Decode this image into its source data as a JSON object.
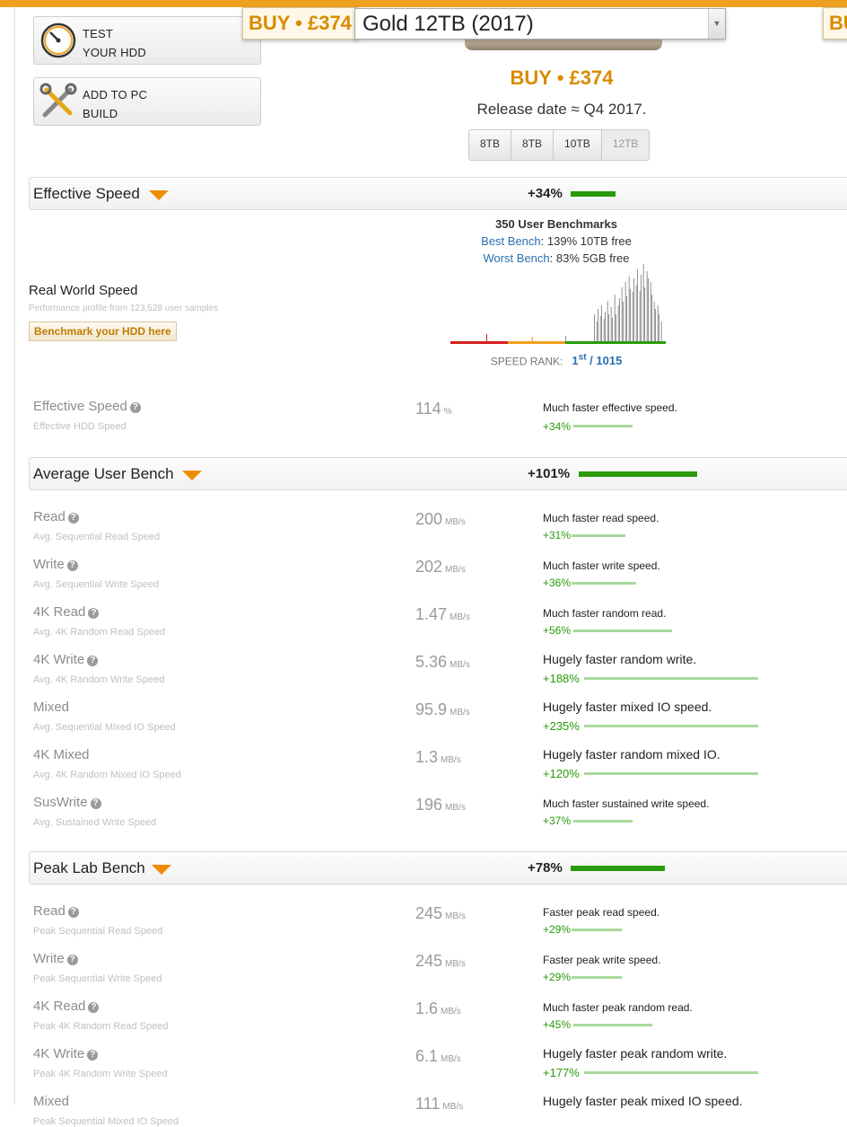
{
  "colors": {
    "accent": "#d98b00",
    "good": "#2a9a0c",
    "link": "#2a6fb0"
  },
  "tools": [
    {
      "line1": "TEST",
      "line2": "YOUR HDD",
      "icon": "gauge-icon"
    },
    {
      "line1": "ADD TO PC",
      "line2": "BUILD",
      "icon": "tools-icon"
    }
  ],
  "buybar": {
    "buy_label": "BUY • £374",
    "model_value": "Gold 12TB (2017)",
    "buy_label_right": "BU"
  },
  "product": {
    "buy_price": "BUY • £374",
    "release": "Release date ≈ Q4 2017.",
    "capacities": [
      "8TB",
      "8TB",
      "10TB",
      "12TB"
    ]
  },
  "effective_speed": {
    "header": {
      "title": "Effective Speed",
      "pct": "+34%"
    },
    "user_bench": {
      "title": "350 User Benchmarks",
      "best_label": "Best Bench",
      "best_value": ": 139% 10TB free",
      "worst_label": "Worst Bench",
      "worst_value": ": 83% 5GB free"
    },
    "rws_title": "Real World Speed",
    "rws_sub": "Performance profile from 123,528 user samples",
    "bench_button": "Benchmark your HDD here",
    "rank_label": "SPEED RANK:",
    "rank_pos": "1",
    "rank_sup": "st",
    "rank_total": " / 1015",
    "metric": {
      "name": "Effective Speed",
      "sub": "Effective HDD Speed",
      "value": "114",
      "unit": "%",
      "desc": "Much faster effective speed.",
      "pct": "+34%"
    }
  },
  "avg_user_bench": {
    "header": {
      "title": "Average User Bench",
      "pct": "+101%"
    },
    "rows": [
      {
        "name": "Read",
        "sub": "Avg. Sequential Read Speed",
        "value": "200",
        "unit": "MB/s",
        "desc": "Much faster read speed.",
        "pct": "+31%"
      },
      {
        "name": "Write",
        "sub": "Avg. Sequential Write Speed",
        "value": "202",
        "unit": "MB/s",
        "desc": "Much faster write speed.",
        "pct": "+36%"
      },
      {
        "name": "4K Read",
        "sub": "Avg. 4K Random Read Speed",
        "value": "1.47",
        "unit": "MB/s",
        "desc": "Much faster random read.",
        "pct": "+56%"
      },
      {
        "name": "4K Write",
        "sub": "Avg. 4K Random Write Speed",
        "value": "5.36",
        "unit": "MB/s",
        "desc": "Hugely faster random write.",
        "pct": "+188%"
      },
      {
        "name": "Mixed",
        "sub": "Avg. Sequential Mixed IO Speed",
        "value": "95.9",
        "unit": "MB/s",
        "desc": "Hugely faster mixed IO speed.",
        "pct": "+235%"
      },
      {
        "name": "4K Mixed",
        "sub": "Avg. 4K Random Mixed IO Speed",
        "value": "1.3",
        "unit": "MB/s",
        "desc": "Hugely faster random mixed IO.",
        "pct": "+120%"
      },
      {
        "name": "SusWrite",
        "sub": "Avg. Sustained Write Speed",
        "value": "196",
        "unit": "MB/s",
        "desc": "Much faster sustained write speed.",
        "pct": "+37%"
      }
    ]
  },
  "peak_lab_bench": {
    "header": {
      "title": "Peak Lab Bench",
      "pct": "+78%"
    },
    "rows": [
      {
        "name": "Read",
        "sub": "Peak Sequential Read Speed",
        "value": "245",
        "unit": "MB/s",
        "desc": "Faster peak read speed.",
        "pct": "+29%"
      },
      {
        "name": "Write",
        "sub": "Peak Sequential Write Speed",
        "value": "245",
        "unit": "MB/s",
        "desc": "Faster peak write speed.",
        "pct": "+29%"
      },
      {
        "name": "4K Read",
        "sub": "Peak 4K Random Read Speed",
        "value": "1.6",
        "unit": "MB/s",
        "desc": "Much faster peak random read.",
        "pct": "+45%"
      },
      {
        "name": "4K Write",
        "sub": "Peak 4K Random Write Speed",
        "value": "6.1",
        "unit": "MB/s",
        "desc": "Hugely faster peak random write.",
        "pct": "+177%"
      },
      {
        "name": "Mixed",
        "sub": "Peak Sequential Mixed IO Speed",
        "value": "111",
        "unit": "MB/s",
        "desc": "Hugely faster peak mixed IO speed.",
        "pct": ""
      }
    ]
  }
}
